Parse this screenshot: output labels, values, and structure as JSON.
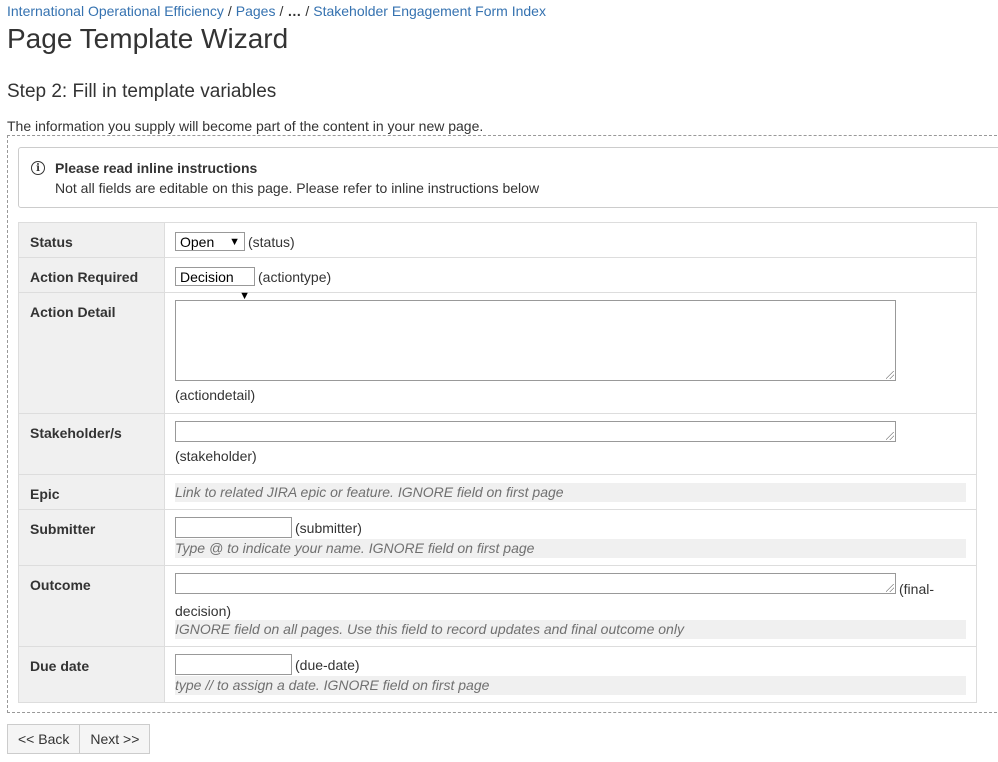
{
  "breadcrumb": {
    "items": [
      "International Operational Efficiency",
      "Pages",
      "…",
      "Stakeholder Engagement Form Index"
    ],
    "separator": "/"
  },
  "page_title": "Page Template Wizard",
  "step_title": "Step 2: Fill in template variables",
  "intro": "The information you supply will become part of the content in your new page.",
  "info_panel": {
    "icon": "info-icon",
    "title": "Please read inline instructions",
    "body": "Not all fields are editable on this page. Please refer to inline instructions below"
  },
  "form": {
    "status": {
      "label": "Status",
      "value": "Open",
      "var": "(status)"
    },
    "action_required": {
      "label": "Action Required",
      "value": "Decision",
      "var": "(actiontype)"
    },
    "action_detail": {
      "label": "Action Detail",
      "value": "",
      "var": "(actiondetail)"
    },
    "stakeholder": {
      "label": "Stakeholder/s",
      "value": "",
      "var": "(stakeholder)"
    },
    "epic": {
      "label": "Epic",
      "hint": "Link to related JIRA epic or feature. IGNORE field on first page"
    },
    "submitter": {
      "label": "Submitter",
      "value": "",
      "var": "(submitter)",
      "hint": "Type @ to indicate your name. IGNORE field on first page"
    },
    "outcome": {
      "label": "Outcome",
      "value": "",
      "var_part1": "(final-",
      "var_part2": "decision)",
      "hint": "IGNORE field on all pages. Use this field to record updates and final outcome only"
    },
    "due_date": {
      "label": "Due date",
      "value": "",
      "var": "(due-date)",
      "hint": "type // to assign a date. IGNORE field on first page"
    }
  },
  "buttons": {
    "back": "<< Back",
    "next": "Next >>"
  },
  "colors": {
    "link": "#3572b0",
    "label_bg": "#f0f0f0",
    "border": "#dddddd"
  }
}
